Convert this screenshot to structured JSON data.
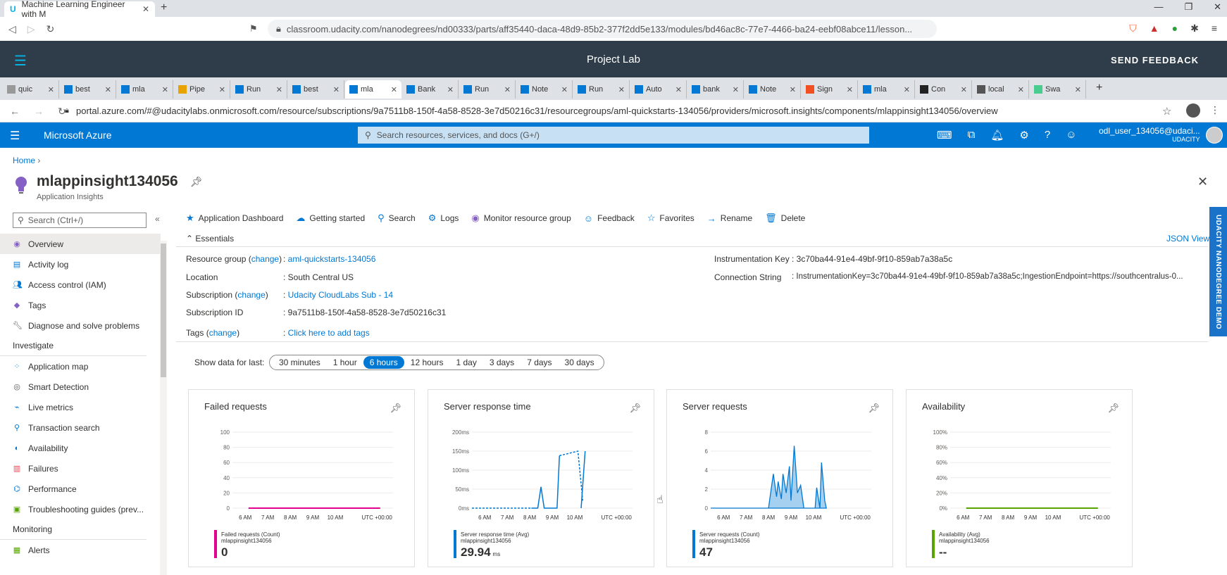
{
  "outer_browser": {
    "tab_title": "Machine Learning Engineer with M",
    "url": "classroom.udacity.com/nanodegrees/nd00333/parts/aff35440-daca-48d9-85b2-377f2dd5e133/modules/bd46ac8c-77e7-4466-ba24-eebf08abce11/lesson..."
  },
  "udacity_bar": {
    "title": "Project Lab",
    "feedback_label": "SEND FEEDBACK"
  },
  "inner_tabs": [
    "quic",
    "best",
    "mla",
    "Pipe",
    "Run",
    "best",
    "mla",
    "Bank",
    "Run",
    "Note",
    "Run",
    "Auto",
    "bank",
    "Note",
    "Sign",
    "mla",
    "Con",
    "local",
    "Swa"
  ],
  "inner_url": "portal.azure.com/#@udacitylabs.onmicrosoft.com/resource/subscriptions/9a7511b8-150f-4a58-8528-3e7d50216c31/resourcegroups/aml-quickstarts-134056/providers/microsoft.insights/components/mlappinsight134056/overview",
  "azure": {
    "brand": "Microsoft Azure",
    "search_placeholder": "Search resources, services, and docs (G+/)",
    "user_name": "odl_user_134056@udaci...",
    "user_org": "UDACITY"
  },
  "breadcrumb": "Home",
  "resource": {
    "title": "mlappinsight134056",
    "subtitle": "Application Insights"
  },
  "nav": {
    "search_placeholder": "Search (Ctrl+/)",
    "items": [
      "Overview",
      "Activity log",
      "Access control (IAM)",
      "Tags",
      "Diagnose and solve problems"
    ],
    "investigate_heading": "Investigate",
    "investigate_items": [
      "Application map",
      "Smart Detection",
      "Live metrics",
      "Transaction search",
      "Availability",
      "Failures",
      "Performance",
      "Troubleshooting guides (prev..."
    ],
    "monitoring_heading": "Monitoring",
    "monitoring_items": [
      "Alerts"
    ]
  },
  "commands": [
    "Application Dashboard",
    "Getting started",
    "Search",
    "Logs",
    "Monitor resource group",
    "Feedback",
    "Favorites",
    "Rename",
    "Delete"
  ],
  "essentials": {
    "heading": "Essentials",
    "json_view": "JSON View",
    "change": "change",
    "resource_group_label": "Resource group",
    "resource_group": "aml-quickstarts-134056",
    "location_label": "Location",
    "location": "South Central US",
    "subscription_label": "Subscription",
    "subscription": "Udacity CloudLabs Sub - 14",
    "subscription_id_label": "Subscription ID",
    "subscription_id": "9a7511b8-150f-4a58-8528-3e7d50216c31",
    "tags_label": "Tags",
    "tags": "Click here to add tags",
    "instrumentation_key_label": "Instrumentation Key",
    "instrumentation_key": "3c70ba44-91e4-49bf-9f10-859ab7a38a5c",
    "connection_string_label": "Connection String",
    "connection_string": "InstrumentationKey=3c70ba44-91e4-49bf-9f10-859ab7a38a5c;IngestionEndpoint=https://southcentralus-0..."
  },
  "time_range": {
    "label": "Show data for last:",
    "options": [
      "30 minutes",
      "1 hour",
      "6 hours",
      "12 hours",
      "1 day",
      "3 days",
      "7 days",
      "30 days"
    ],
    "selected": "6 hours"
  },
  "x_ticks": [
    "6 AM",
    "7 AM",
    "8 AM",
    "9 AM",
    "10 AM",
    "UTC +00:00"
  ],
  "cards": [
    {
      "title": "Failed requests",
      "legend1": "Failed requests (Count)",
      "legend2": "mlappinsight134056",
      "value": "0",
      "unit": "",
      "color": "#e3008c",
      "yticks": [
        "100",
        "80",
        "60",
        "40",
        "20",
        "0"
      ]
    },
    {
      "title": "Server response time",
      "legend1": "Server response time (Avg)",
      "legend2": "mlappinsight134056",
      "value": "29.94",
      "unit": "ms",
      "color": "#0078d4",
      "yticks": [
        "200ms",
        "150ms",
        "100ms",
        "50ms",
        "0ms"
      ]
    },
    {
      "title": "Server requests",
      "legend1": "Server requests (Count)",
      "legend2": "mlappinsight134056",
      "value": "47",
      "unit": "",
      "color": "#0078d4",
      "yticks": [
        "8",
        "6",
        "4",
        "2",
        "0"
      ]
    },
    {
      "title": "Availability",
      "legend1": "Availability (Avg)",
      "legend2": "mlappinsight134056",
      "value": "--",
      "unit": "",
      "color": "#57a300",
      "yticks": [
        "100%",
        "80%",
        "60%",
        "40%",
        "20%",
        "0%"
      ]
    }
  ],
  "side_tab": "UDACITY NANODEGREE DEMO"
}
